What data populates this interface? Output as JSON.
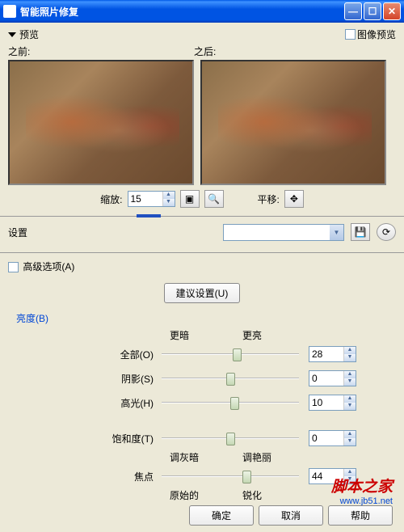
{
  "title": "智能照片修复",
  "preview": {
    "label": "预览",
    "img_checkbox_label": "图像预览",
    "before": "之前:",
    "after": "之后:"
  },
  "zoom": {
    "label": "缩放:",
    "value": "15",
    "pan_label": "平移:"
  },
  "settings": {
    "label": "设置"
  },
  "advanced": {
    "label": "高级选项(A)"
  },
  "suggest": {
    "label": "建议设置(U)"
  },
  "brightness": {
    "title": "亮度(B)",
    "darker": "更暗",
    "lighter": "更亮",
    "rows": [
      {
        "name": "全部(O)",
        "value": "28",
        "pos": 88
      },
      {
        "name": "阴影(S)",
        "value": "0",
        "pos": 80
      },
      {
        "name": "高光(H)",
        "value": "10",
        "pos": 85
      }
    ]
  },
  "saturation": {
    "name": "饱和度(T)",
    "value": "0",
    "pos": 80,
    "dull": "调灰暗",
    "vivid": "调艳丽"
  },
  "focus": {
    "name": "焦点",
    "value": "44",
    "pos": 100,
    "orig": "原始的",
    "sharp": "锐化"
  },
  "buttons": {
    "ok": "确定",
    "cancel": "取消",
    "help": "帮助"
  },
  "watermark": {
    "line1": "脚本之家",
    "line2": "www.jb51.net"
  }
}
